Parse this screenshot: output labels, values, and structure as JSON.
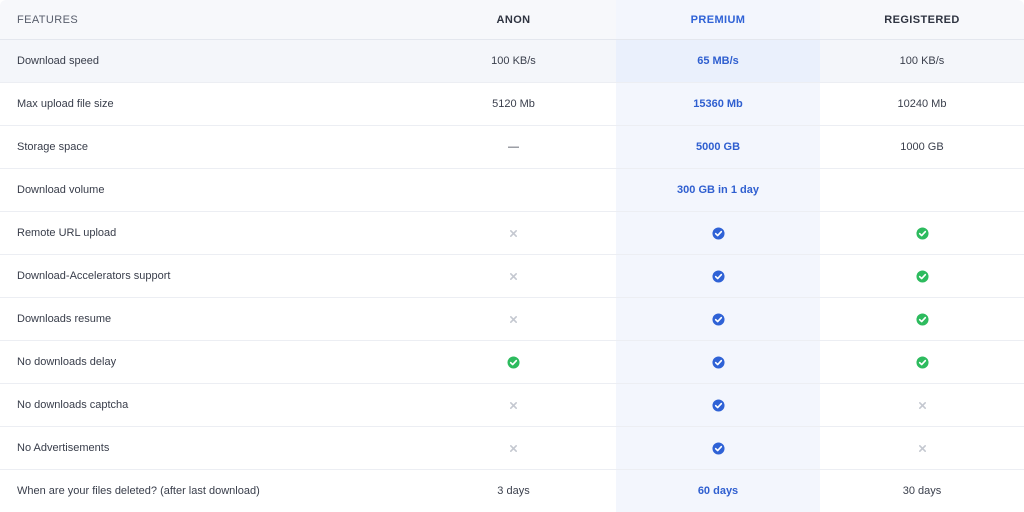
{
  "colors": {
    "premium_accent": "#2f62d6",
    "check_blue": "#2f62d6",
    "check_green": "#2dbb5e",
    "cross_gray": "#c4c8d0"
  },
  "header": {
    "features": "FEATURES",
    "anon": "ANON",
    "premium": "PREMIUM",
    "registered": "REGISTERED"
  },
  "rows": [
    {
      "feature": "Download speed",
      "anon": "100 KB/s",
      "premium": "65 MB/s",
      "registered": "100 KB/s"
    },
    {
      "feature": "Max upload file size",
      "anon": "5120 Mb",
      "premium": "15360 Mb",
      "registered": "10240 Mb"
    },
    {
      "feature": "Storage space",
      "anon": "—",
      "premium": "5000 GB",
      "registered": "1000 GB"
    },
    {
      "feature": "Download volume",
      "anon": "",
      "premium": "300 GB in 1 day",
      "registered": ""
    },
    {
      "feature": "Remote URL upload",
      "anon": "cross-icon",
      "premium": "check-blue-icon",
      "registered": "check-green-icon"
    },
    {
      "feature": "Download-Accelerators support",
      "anon": "cross-icon",
      "premium": "check-blue-icon",
      "registered": "check-green-icon"
    },
    {
      "feature": "Downloads resume",
      "anon": "cross-icon",
      "premium": "check-blue-icon",
      "registered": "check-green-icon"
    },
    {
      "feature": "No downloads delay",
      "anon": "check-green-icon",
      "premium": "check-blue-icon",
      "registered": "check-green-icon"
    },
    {
      "feature": "No downloads captcha",
      "anon": "cross-icon",
      "premium": "check-blue-icon",
      "registered": "cross-icon"
    },
    {
      "feature": "No Advertisements",
      "anon": "cross-icon",
      "premium": "check-blue-icon",
      "registered": "cross-icon"
    },
    {
      "feature": "When are your files deleted? (after last download)",
      "anon": "3 days",
      "premium": "60 days",
      "registered": "30 days"
    }
  ]
}
